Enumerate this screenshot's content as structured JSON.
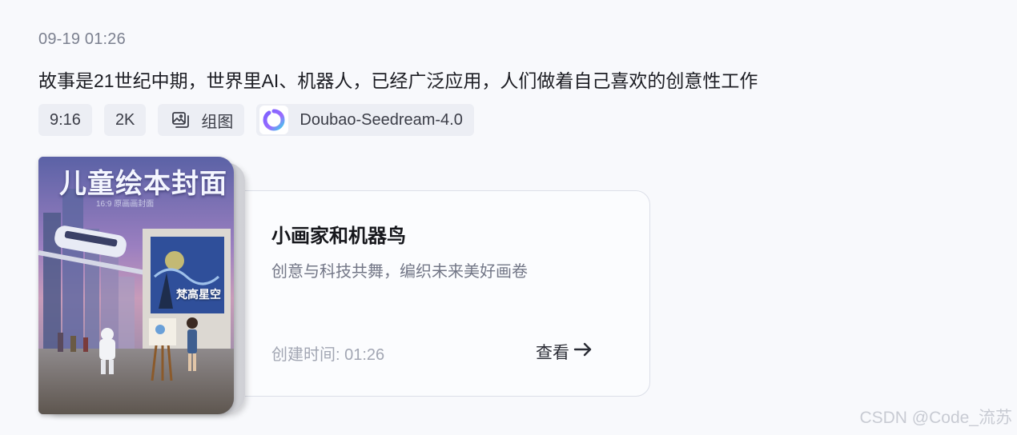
{
  "message": {
    "timestamp": "09-19 01:26",
    "prompt": "故事是21世纪中期，世界里AI、机器人，已经广泛应用，人们做着自己喜欢的创意性工作"
  },
  "tags": {
    "ratio": "9:16",
    "resolution": "2K",
    "mode_icon": "image-set-icon",
    "mode": "组图",
    "model_icon": "doubao-logo-icon",
    "model": "Doubao-Seedream-4.0"
  },
  "result_card": {
    "cover": {
      "title": "儿童绘本封面",
      "subtitle": "16:9 原画画封面",
      "painting_label": "梵高星空"
    },
    "title": "小画家和机器鸟",
    "subtitle": "创意与科技共舞，编织未来美好画卷",
    "created_time": "创建时间: 01:26",
    "view_label": "查看",
    "view_icon": "arrow-right-icon"
  },
  "watermark": "CSDN @Code_流苏",
  "colors": {
    "background": "#f8f9fc",
    "tag_background": "#eceef4",
    "card_border": "#dcdfe8",
    "logo_gradient_start": "#7b61ff",
    "logo_gradient_end": "#3fd0e8"
  }
}
